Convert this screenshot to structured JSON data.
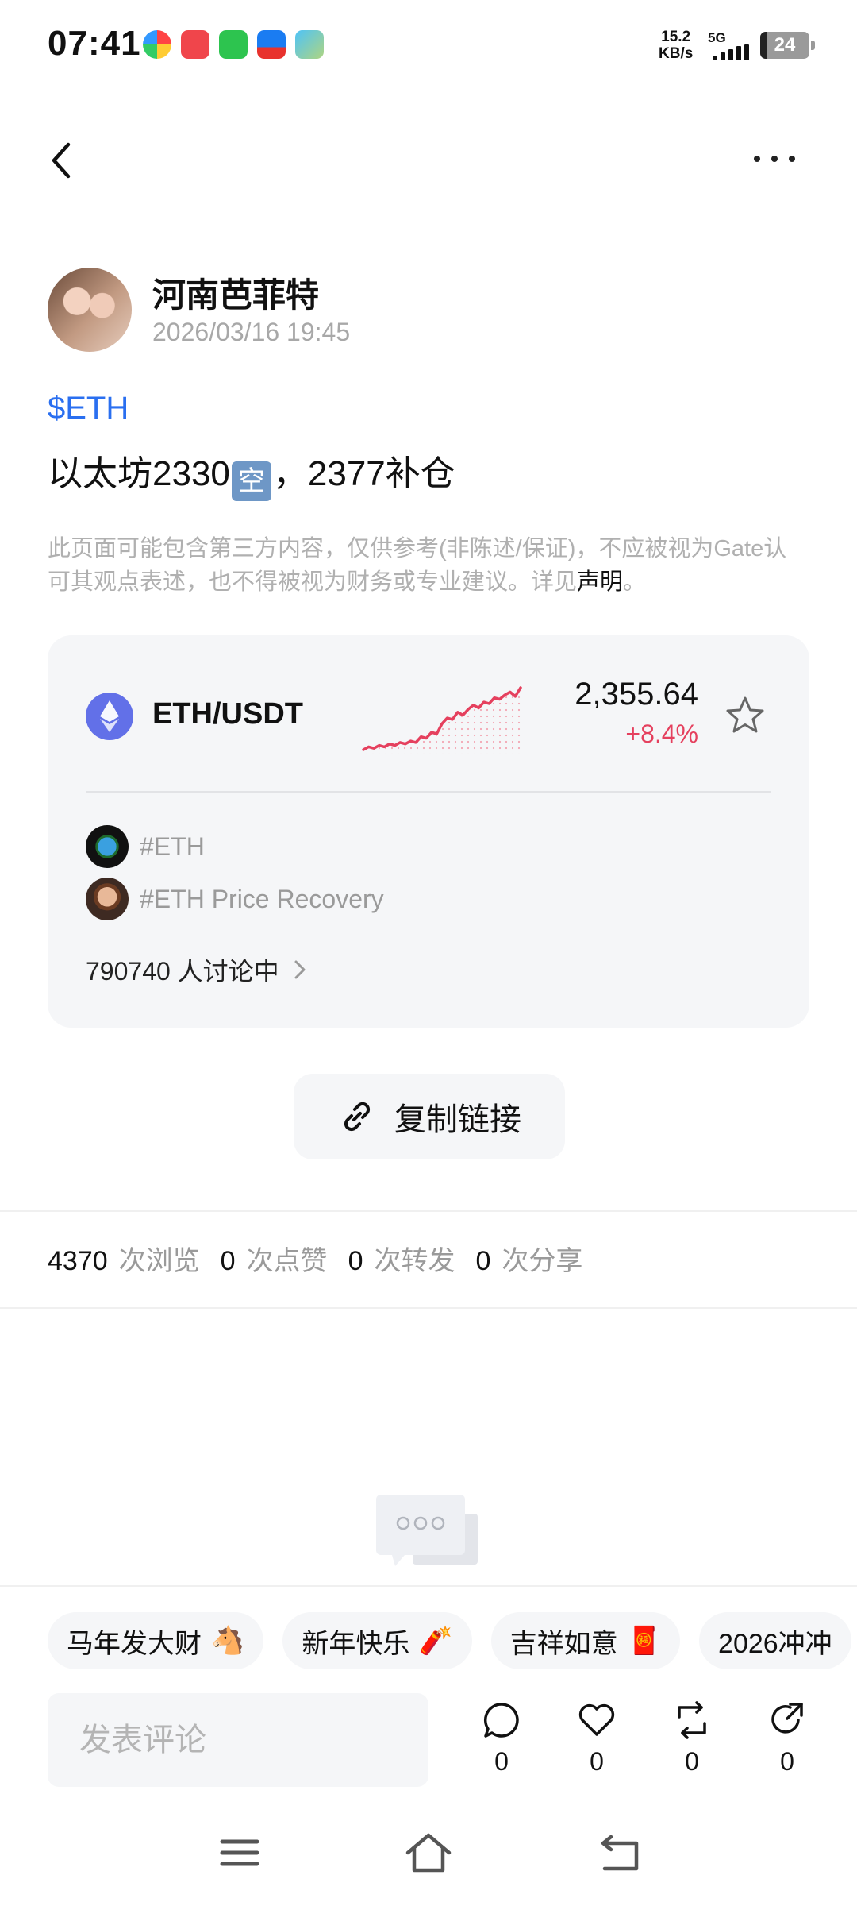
{
  "status_bar": {
    "time": "07:41",
    "net_speed_value": "15.2",
    "net_speed_unit": "KB/s",
    "network": "5G",
    "battery": "24",
    "app_icons": [
      "pinwheel-app-icon",
      "video-app-icon",
      "wechat-icon",
      "alipay-icon",
      "game-app-icon"
    ]
  },
  "post": {
    "author": "河南芭菲特",
    "time": "2026/03/16 19:45",
    "ticker": "$ETH",
    "text_before": "以太坊2330",
    "text_emoji": "空",
    "text_after": "，2377补仓",
    "disclaimer_text": "此页面可能包含第三方内容，仅供参考(非陈述/保证)，不应被视为Gate认可其观点表述，也不得被视为财务或专业建议。详见",
    "disclaimer_link": "声明",
    "disclaimer_end": "。"
  },
  "market_card": {
    "pair": "ETH/USDT",
    "price": "2,355.64",
    "change": "+8.4%",
    "change_color": "#e5405e",
    "sparkline": [
      12,
      14,
      13,
      15,
      14,
      16,
      15,
      17,
      16,
      18,
      17,
      21,
      20,
      24,
      23,
      30,
      34,
      33,
      38,
      36,
      40,
      43,
      41,
      45,
      44,
      48,
      47,
      50,
      52,
      49,
      55
    ],
    "topics": [
      {
        "label": "#ETH",
        "icon": "earth-avatar"
      },
      {
        "label": "#ETH Price Recovery",
        "icon": "person-avatar"
      }
    ],
    "discussing": "790740 人讨论中"
  },
  "copy_link": "复制链接",
  "stats": [
    {
      "count": "4370",
      "label": "次浏览"
    },
    {
      "count": "0",
      "label": "次点赞"
    },
    {
      "count": "0",
      "label": "次转发"
    },
    {
      "count": "0",
      "label": "次分享"
    }
  ],
  "chips": [
    {
      "label": "马年发大财",
      "emoji": "🐴"
    },
    {
      "label": "新年快乐",
      "emoji": "🧨"
    },
    {
      "label": "吉祥如意",
      "emoji": "🧧"
    },
    {
      "label": "2026冲冲",
      "emoji": ""
    }
  ],
  "comment": {
    "placeholder": "发表评论",
    "actions": [
      {
        "name": "comment",
        "count": "0"
      },
      {
        "name": "like",
        "count": "0"
      },
      {
        "name": "repost",
        "count": "0"
      },
      {
        "name": "share",
        "count": "0"
      }
    ]
  },
  "colors": {
    "accent": "#2a6ff0",
    "negative_red": "#e5405e",
    "eth_blue": "#6270e8"
  }
}
